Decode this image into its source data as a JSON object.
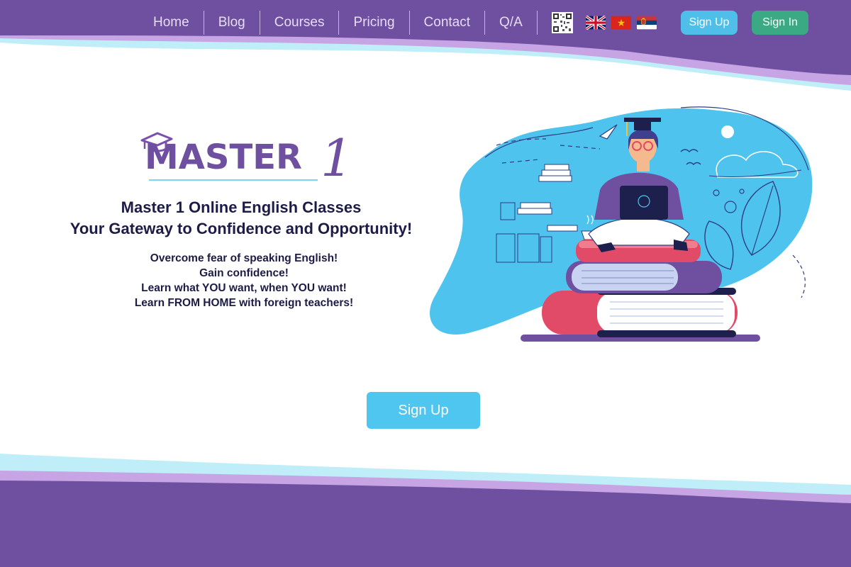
{
  "nav": {
    "links": [
      "Home",
      "Blog",
      "Courses",
      "Pricing",
      "Contact",
      "Q/A"
    ],
    "qr_icon": "qr-code-icon",
    "flags": [
      "uk-flag-icon",
      "vietnam-flag-icon",
      "serbia-flag-icon"
    ],
    "signup_label": "Sign Up",
    "signin_label": "Sign In"
  },
  "hero": {
    "logo_text": "MASTER",
    "logo_numeral": "1",
    "title_line1": "Master 1 Online English Classes",
    "title_line2": "Your Gateway to Confidence and Opportunity!",
    "points": [
      "Overcome fear of speaking English!",
      "Gain confidence!",
      "Learn what YOU want, when YOU want!",
      "Learn FROM HOME with foreign teachers!"
    ],
    "cta_label": "Sign Up"
  },
  "colors": {
    "purple": "#6f4f9f",
    "accent_blue": "#4fc6ef",
    "green": "#3aa984",
    "dark_text": "#1c1c46"
  }
}
